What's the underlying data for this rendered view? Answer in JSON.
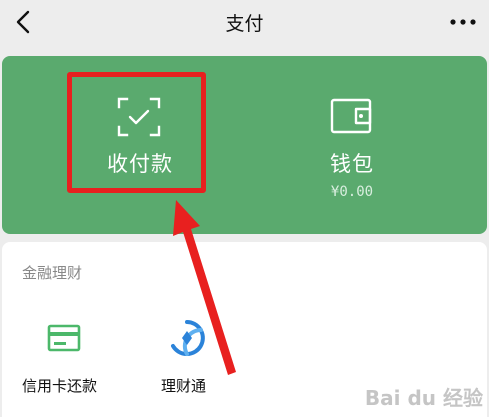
{
  "header": {
    "title": "支付",
    "back_icon": "chevron-left-icon",
    "more_icon": "more-dots-icon"
  },
  "green_card": {
    "background": "#5aaa6e",
    "tiles": [
      {
        "label": "收付款",
        "icon": "scan-icon"
      },
      {
        "label": "钱包",
        "sub": "¥0.00",
        "icon": "wallet-icon"
      }
    ]
  },
  "finance": {
    "title": "金融理财",
    "items": [
      {
        "label": "信用卡还款",
        "icon": "credit-card-icon",
        "color": "#4cb86a"
      },
      {
        "label": "理财通",
        "icon": "licaitong-icon",
        "color": "#2b83d9"
      }
    ]
  },
  "annotation": {
    "highlight_color": "#e8201f"
  },
  "watermark": {
    "text": "Bai du 经验"
  }
}
